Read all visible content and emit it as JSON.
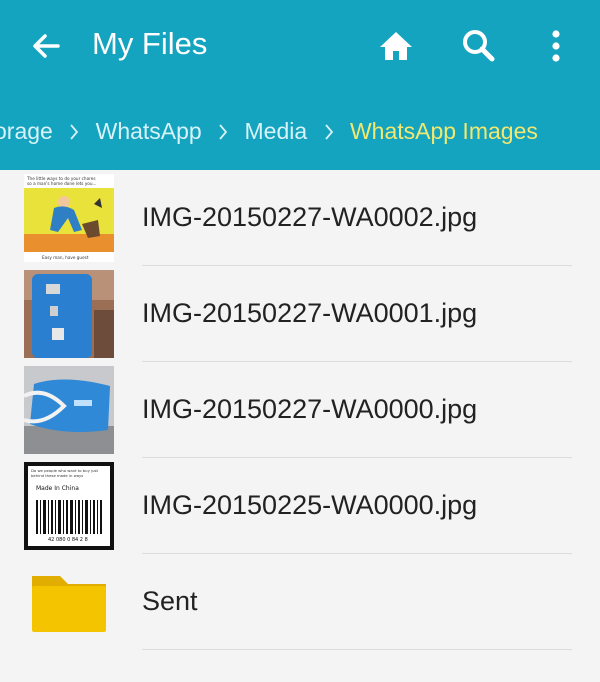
{
  "header": {
    "title": "My Files",
    "back_icon": "back-arrow-icon",
    "actions": [
      "home-icon",
      "search-icon",
      "more-vert-icon"
    ]
  },
  "breadcrumb": [
    "orage",
    "WhatsApp",
    "Media",
    "WhatsApp Images"
  ],
  "files": [
    {
      "name": "IMG-20150227-WA0002.jpg",
      "type": "image",
      "thumbnail": "cartoon-image-thumbnail",
      "thumb_text": [
        "The little ways to do your chores",
        "so a man's home done lets you...",
        "Easy man, have guest"
      ]
    },
    {
      "name": "IMG-20150227-WA0001.jpg",
      "type": "image",
      "thumbnail": "powerbank-photo-thumbnail"
    },
    {
      "name": "IMG-20150227-WA0000.jpg",
      "type": "image",
      "thumbnail": "blue-device-photo-thumbnail"
    },
    {
      "name": "IMG-20150225-WA0000.jpg",
      "type": "image",
      "thumbnail": "barcode-image-thumbnail",
      "thumb_text": [
        "Do we people who want to buy just",
        "behind these made in ways",
        "Made In China",
        "42 080 0 84 2 8"
      ]
    },
    {
      "name": "Sent",
      "type": "folder",
      "thumbnail": "folder-icon"
    }
  ],
  "colors": {
    "appbar": "#14a4bf",
    "current_crumb": "#f1e86f",
    "folder": "#f5c400"
  }
}
